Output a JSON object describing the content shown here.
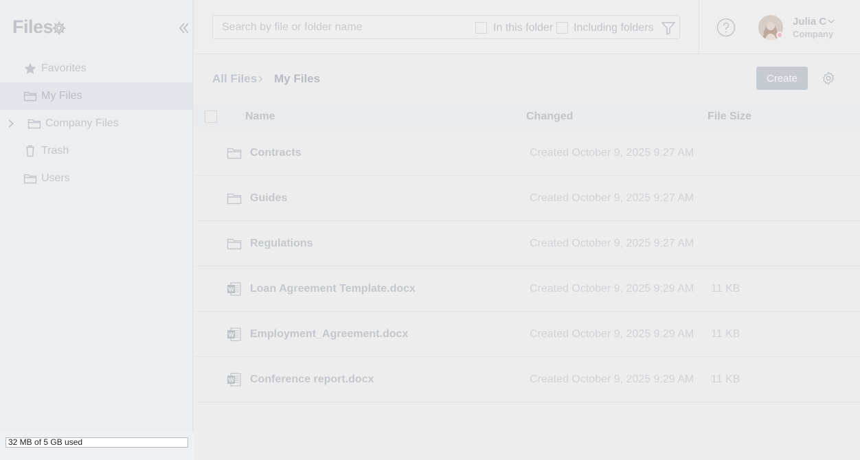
{
  "app": {
    "title": "Files"
  },
  "sidebar": {
    "items": [
      {
        "label": "Favorites",
        "icon": "star-icon",
        "active": false
      },
      {
        "label": "My Files",
        "icon": "folder-icon",
        "active": true
      },
      {
        "label": "Company Files",
        "icon": "folder-icon",
        "active": false,
        "expandable": true
      },
      {
        "label": "Trash",
        "icon": "trash-icon",
        "active": false
      },
      {
        "label": "Users",
        "icon": "folder-icon",
        "active": false
      }
    ],
    "storage": "32 MB of 5 GB used"
  },
  "search": {
    "placeholder": "Search by file or folder name",
    "in_folder_label": "In this folder",
    "including_folders_label": "Including folders"
  },
  "user": {
    "name": "Julia C",
    "company": "Company",
    "status_color": "#f2b9c4"
  },
  "breadcrumb": {
    "root": "All Files",
    "current": "My Files"
  },
  "toolbar": {
    "create_label": "Create"
  },
  "table": {
    "headers": {
      "name": "Name",
      "changed": "Changed",
      "size": "File Size"
    },
    "rows": [
      {
        "type": "folder",
        "icon": "folder-icon",
        "name": "Contracts",
        "changed": "Created October 9, 2025 9:27 AM",
        "size": ""
      },
      {
        "type": "folder",
        "icon": "folder-icon",
        "name": "Guides",
        "changed": "Created October 9, 2025 9:27 AM",
        "size": ""
      },
      {
        "type": "folder",
        "icon": "folder-icon",
        "name": "Regulations",
        "changed": "Created October 9, 2025 9:27 AM",
        "size": ""
      },
      {
        "type": "docx",
        "icon": "word-doc-icon",
        "name": "Loan Agreement Template.docx",
        "changed": "Created October 9, 2025 9:29 AM",
        "size": "11 KB"
      },
      {
        "type": "docx",
        "icon": "word-doc-icon",
        "name": "Employment_Agreement.docx",
        "changed": "Created October 9, 2025 9:29 AM",
        "size": "11 KB"
      },
      {
        "type": "docx",
        "icon": "word-doc-icon",
        "name": "Conference report.docx",
        "changed": "Created October 9, 2025 9:29 AM",
        "size": "11 KB"
      }
    ]
  }
}
